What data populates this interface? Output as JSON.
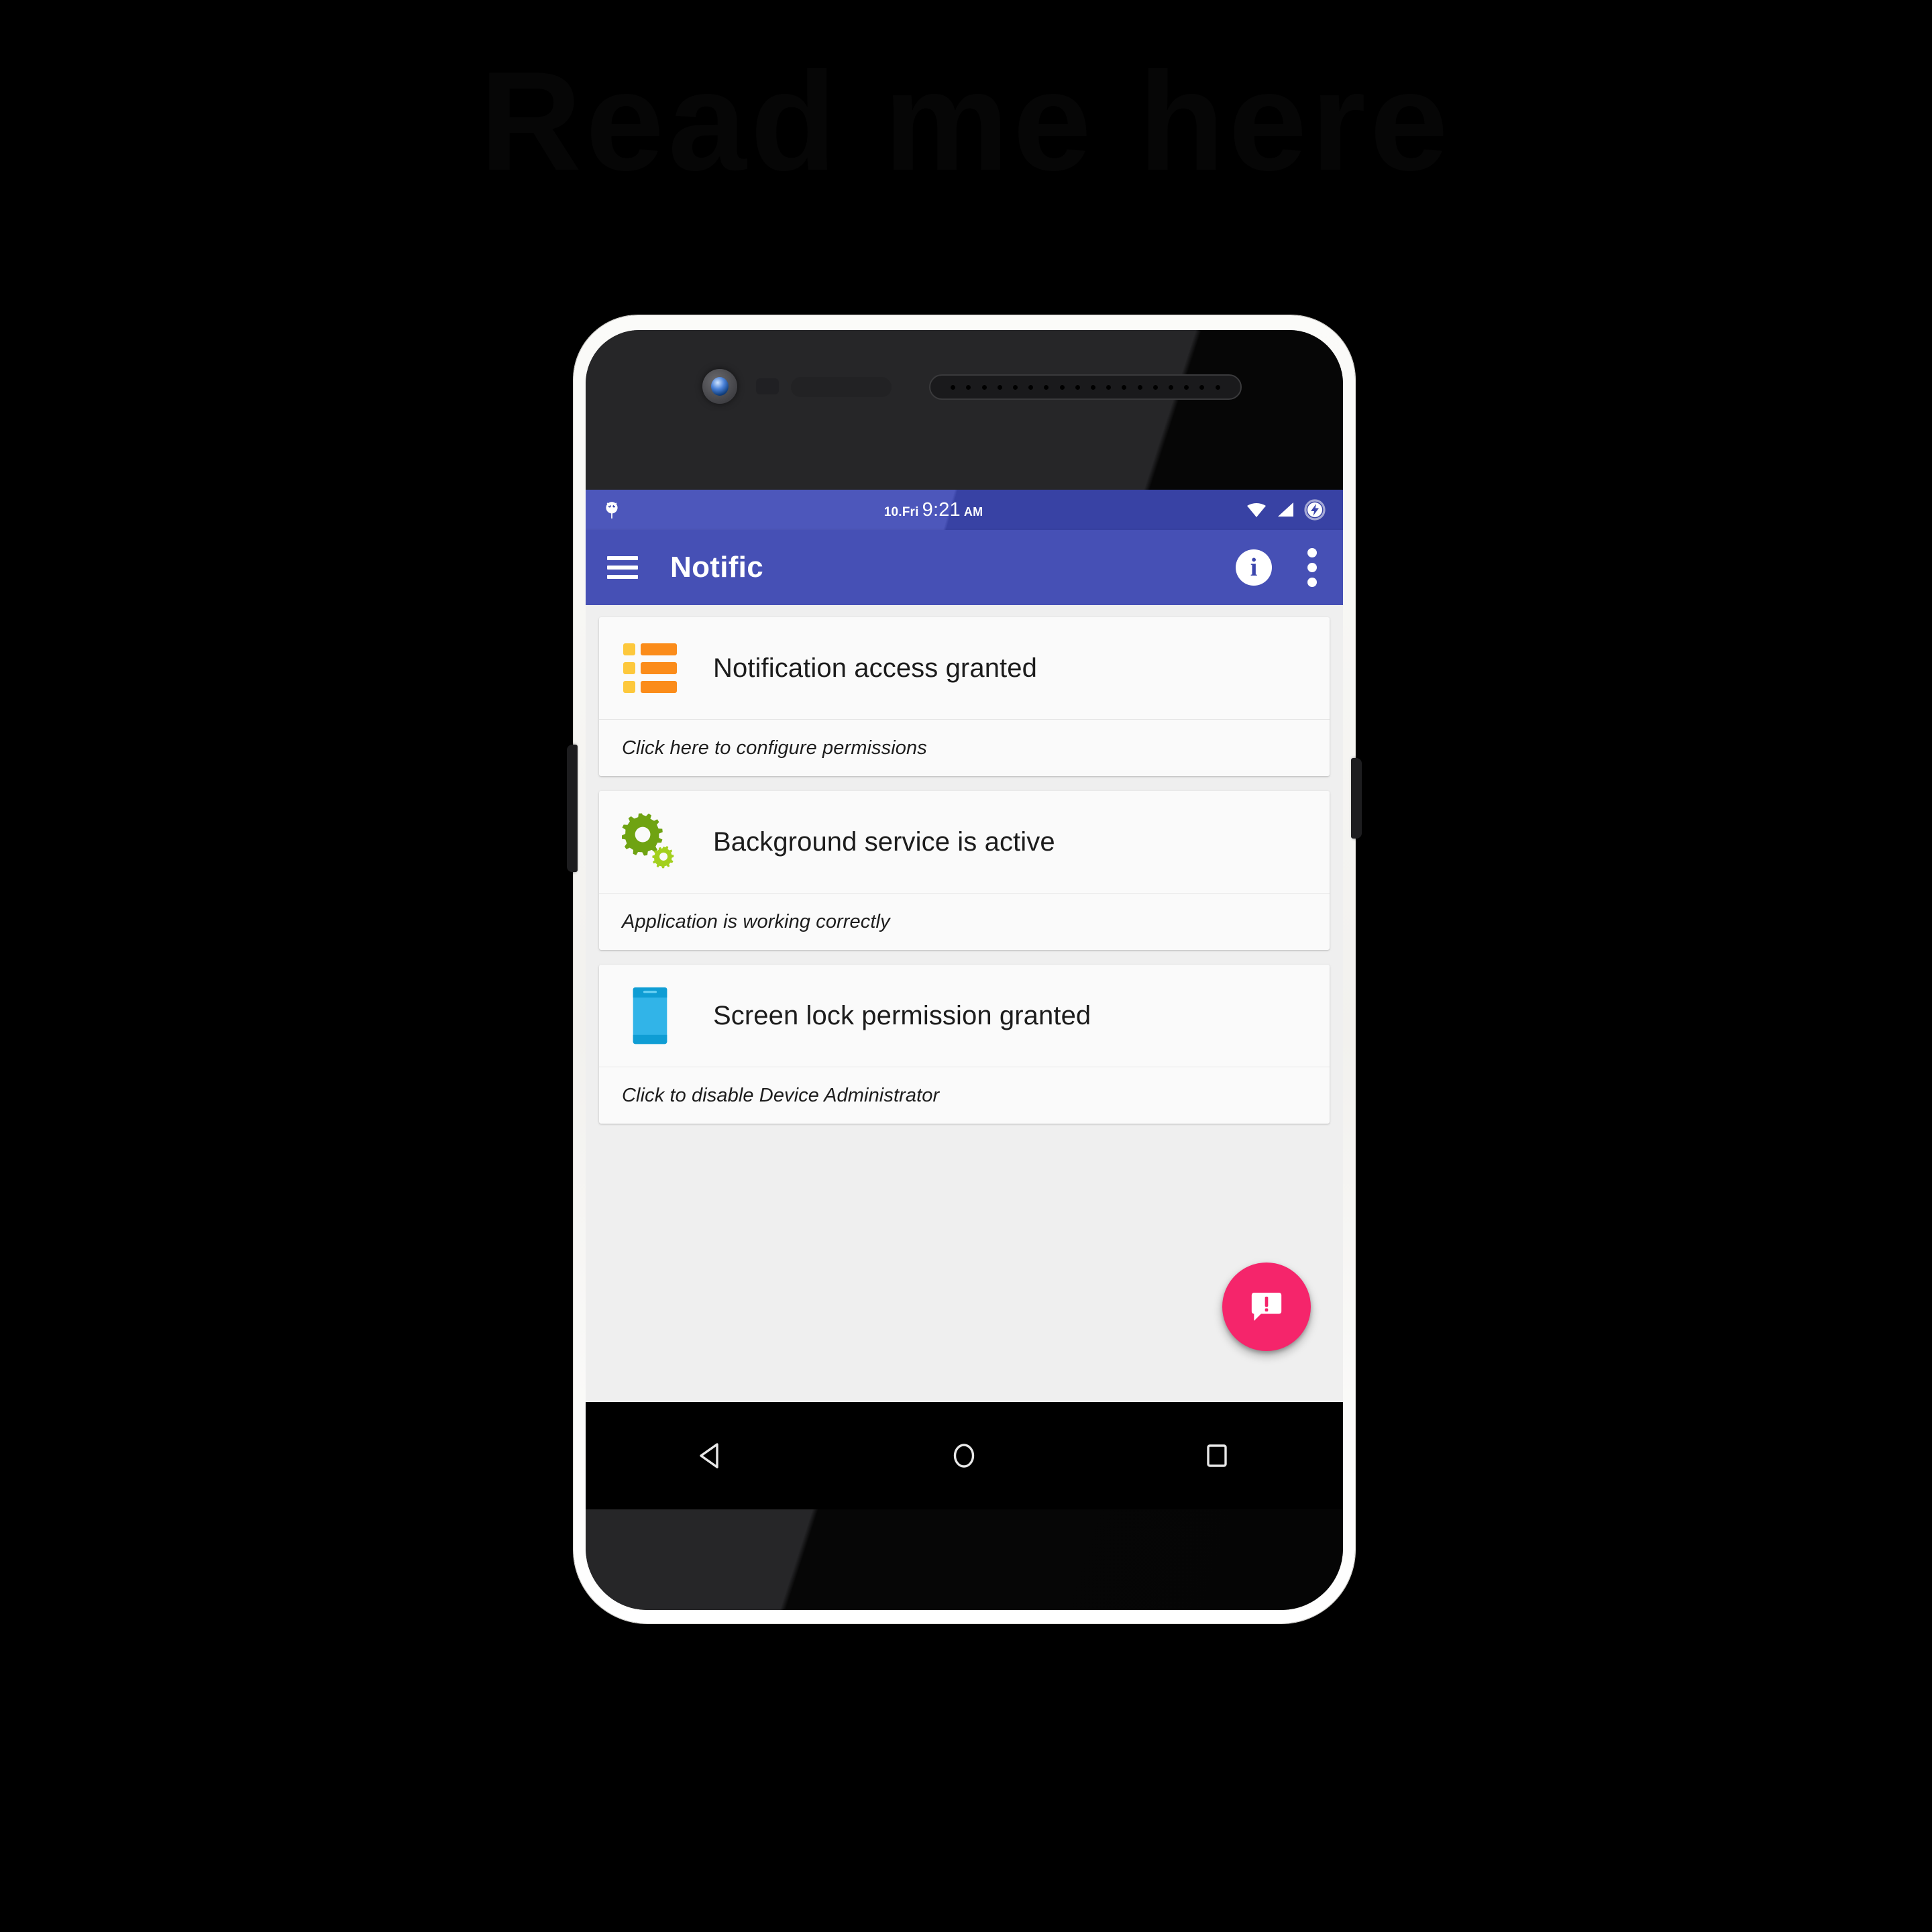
{
  "watermark": {
    "text": "Read me here"
  },
  "device": {
    "frame_color": "#f6f5f2",
    "bezel_color": "#0b0b0b",
    "hardware": {
      "front_camera": "front-camera",
      "proximity_sensor": "proximity-sensor",
      "light_sensor": "light-sensor",
      "earpiece_speaker": "earpiece-speaker",
      "volume_rocker": "volume-rocker",
      "power_button": "power-button"
    }
  },
  "statusbar": {
    "background": "#3d48ad",
    "left_icons": [
      "android-debug-bug-icon"
    ],
    "clock": {
      "date": "10.Fri",
      "time": "9:21",
      "meridiem": "AM"
    },
    "right_icons": [
      "wifi-icon",
      "cellular-signal-icon",
      "battery-charging-icon"
    ]
  },
  "appbar": {
    "background": "#4650b5",
    "menu_icon": "hamburger-menu-icon",
    "title": "Notific",
    "info_label": "i",
    "info_icon": "info-icon",
    "overflow_icon": "overflow-menu-icon"
  },
  "content": {
    "background": "#efefef",
    "cards": [
      {
        "icon": "notification-list-icon",
        "icon_colors": {
          "bullet": "#fdc83c",
          "bar": "#fb8c1a"
        },
        "title": "Notification access granted",
        "subtitle": "Click here to configure permissions"
      },
      {
        "icon": "gears-icon",
        "icon_colors": {
          "large_gear": "#6fa312",
          "small_gear": "#a3d01e"
        },
        "title": "Background service is active",
        "subtitle": "Application is working correctly"
      },
      {
        "icon": "smartphone-icon",
        "icon_colors": {
          "body": "#31b4e8",
          "top_bar": "#0f9dd4"
        },
        "title": "Screen lock permission granted",
        "subtitle": "Click to disable Device Administrator"
      }
    ]
  },
  "fab": {
    "color": "#f5256b",
    "icon": "feedback-speech-bubble-exclamation-icon"
  },
  "navbar": {
    "background": "#000000",
    "buttons": [
      {
        "name": "back",
        "icon": "back-triangle-icon"
      },
      {
        "name": "home",
        "icon": "home-circle-icon"
      },
      {
        "name": "recents",
        "icon": "recents-square-icon"
      }
    ]
  }
}
